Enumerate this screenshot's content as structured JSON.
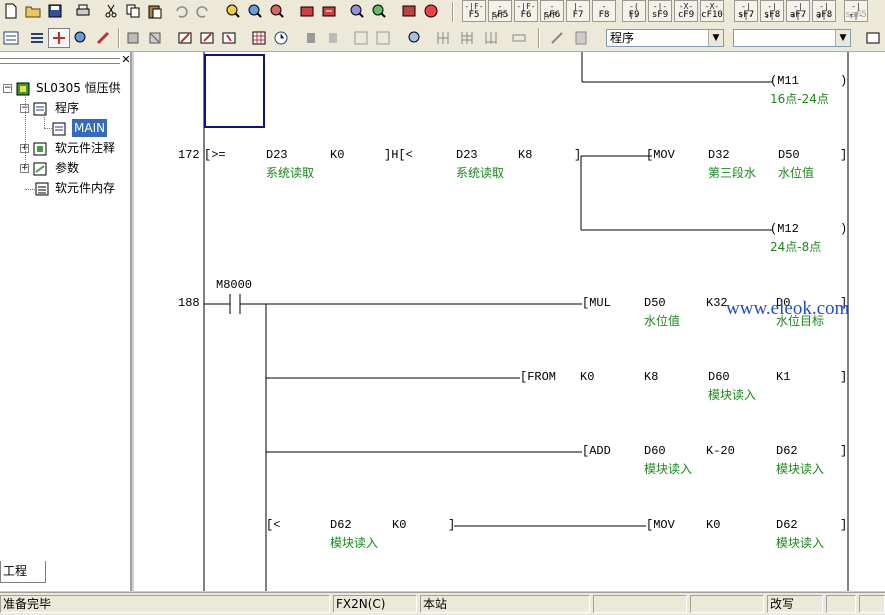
{
  "fkeys": [
    {
      "sym": "-|F-",
      "label": "F5"
    },
    {
      "sym": "-|/F-",
      "label": "sF5"
    },
    {
      "sym": "-|F-",
      "label": "F6"
    },
    {
      "sym": "-|/F-",
      "label": "sF6"
    },
    {
      "sym": "|-",
      "label": "F7"
    },
    {
      "sym": "-",
      "label": "F8"
    },
    {
      "sym": "-( )-",
      "label": "F9"
    },
    {
      "sym": "-|-",
      "label": "sF9"
    },
    {
      "sym": "-X-",
      "label": "cF9"
    },
    {
      "sym": "-X-",
      "label": "cF10"
    },
    {
      "sym": "-|↑|-",
      "label": "sF7"
    },
    {
      "sym": "-|↓|-",
      "label": "sF8"
    },
    {
      "sym": "-|↑|-",
      "label": "aF7"
    },
    {
      "sym": "-|↓|-",
      "label": "aF8"
    },
    {
      "sym": "-|↑|-",
      "label": "saF5"
    }
  ],
  "combos": {
    "program": "程序",
    "second": ""
  },
  "tree": {
    "root": "SL0305 恒压供",
    "program": "程序",
    "main": "MAIN",
    "device_comment": "软元件注释",
    "params": "参数",
    "device_memory": "软元件内存"
  },
  "tab_label": "工程",
  "ladder": {
    "rung_numbers": [
      "172",
      "188"
    ],
    "r0": {
      "coil": "(M11",
      "comment": "16点-24点"
    },
    "r1": {
      "cmp1": "[>=",
      "op1": "D23",
      "op2": "K0",
      "op1_cmt": "系统读取",
      "cmp2": "]H[<",
      "op3": "D23",
      "op4": "K8",
      "op3_cmt": "系统读取",
      "mov": "[MOV",
      "src": "D32",
      "dst": "D50",
      "src_cmt": "第三段水",
      "dst_cmt": "水位值",
      "coil": "(M12",
      "coil_cmt": "24点-8点"
    },
    "r2": {
      "contact": "M8000",
      "mul": "[MUL",
      "mul_a": "D50",
      "mul_b": "K32",
      "mul_c": "D0",
      "mul_a_cmt": "水位值",
      "mul_c_cmt": "水位目标",
      "from": "[FROM",
      "from_a": "K0",
      "from_b": "K8",
      "from_c": "D60",
      "from_d": "K1",
      "from_c_cmt": "模块读入",
      "add": "[ADD",
      "add_a": "D60",
      "add_b": "K-20",
      "add_c": "D62",
      "add_a_cmt": "模块读入",
      "add_c_cmt": "模块读入",
      "cmp": "[<",
      "cmp_a": "D62",
      "cmp_b": "K0",
      "cmp_a_cmt": "模块读入",
      "mov": "[MOV",
      "mov_a": "K0",
      "mov_b": "D62",
      "mov_b_cmt": "模块读入"
    },
    "watermark": "www.eleok.com"
  },
  "status": {
    "ready": "准备完毕",
    "plc": "FX2N(C)",
    "station": "本站",
    "ovr": "改写"
  }
}
